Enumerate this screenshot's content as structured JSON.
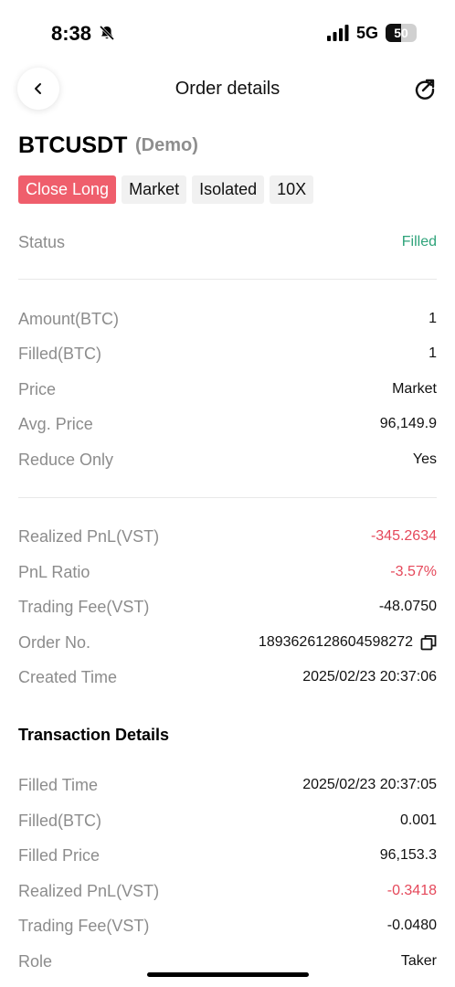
{
  "status_bar": {
    "time": "8:38",
    "network": "5G",
    "battery": "50",
    "battery_level": 0.5
  },
  "header": {
    "title": "Order details"
  },
  "order": {
    "pair": "BTCUSDT",
    "mode": "(Demo)",
    "tags": [
      "Close Long",
      "Market",
      "Isolated",
      "10X"
    ],
    "status_label": "Status",
    "status_value": "Filled",
    "details": [
      {
        "label": "Amount(BTC)",
        "value": "1"
      },
      {
        "label": "Filled(BTC)",
        "value": "1"
      },
      {
        "label": "Price",
        "value": "Market"
      },
      {
        "label": "Avg. Price",
        "value": "96,149.9"
      },
      {
        "label": "Reduce Only",
        "value": "Yes"
      }
    ],
    "pnl": [
      {
        "label": "Realized PnL(VST)",
        "value": "-345.2634"
      },
      {
        "label": "PnL Ratio",
        "value": "-3.57%"
      },
      {
        "label": "Trading Fee(VST)",
        "value": "-48.0750"
      },
      {
        "label": "Order No.",
        "value": "1893626128604598272"
      },
      {
        "label": "Created Time",
        "value": "2025/02/23 20:37:06"
      }
    ]
  },
  "transaction": {
    "title": "Transaction Details",
    "rows": [
      {
        "label": "Filled Time",
        "value": "2025/02/23 20:37:05"
      },
      {
        "label": "Filled(BTC)",
        "value": "0.001"
      },
      {
        "label": "Filled Price",
        "value": "96,153.3"
      },
      {
        "label": "Realized PnL(VST)",
        "value": "-0.3418"
      },
      {
        "label": "Trading Fee(VST)",
        "value": "-0.0480"
      },
      {
        "label": "Role",
        "value": "Taker"
      }
    ]
  },
  "colors": {
    "accent_red": "#ef5e6c",
    "loss_red": "#e5485a",
    "success_green": "#2ea37a",
    "label_gray": "#8c8c8c"
  },
  "icons": {
    "back": "chevron-left-icon",
    "share": "share-arrow-icon",
    "copy": "copy-icon",
    "silent": "bell-slash-icon",
    "signal": "signal-icon"
  }
}
